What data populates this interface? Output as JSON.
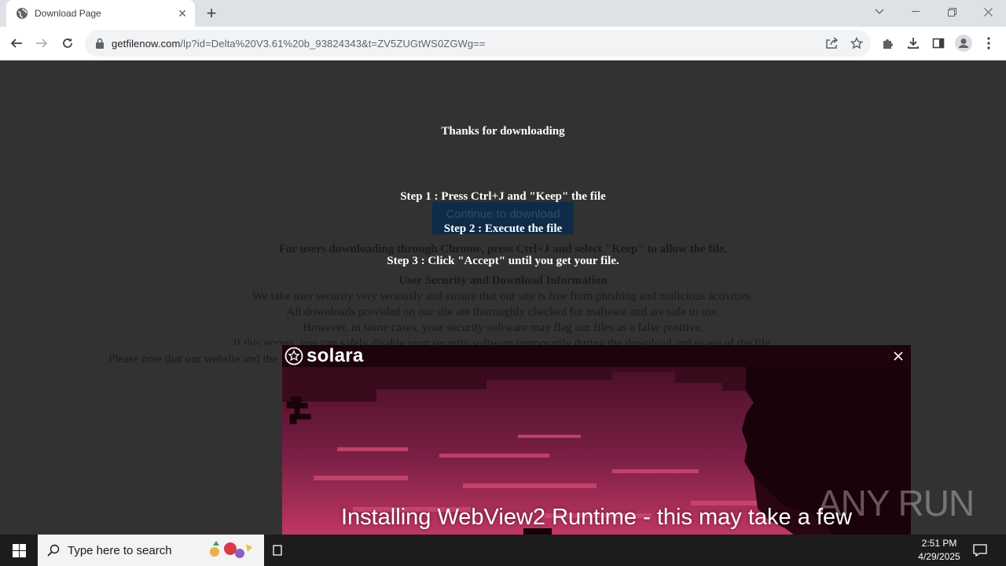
{
  "browser": {
    "tab_title": "Download Page",
    "tab_close": "✕",
    "new_tab": "+",
    "url_host": "getfilenow.com",
    "url_path": "/lp?id=Delta%20V3.61%20b_93824343&t=ZV5ZUGtWS0ZGWg=="
  },
  "page": {
    "thanks": "Thanks for downloading",
    "continue_button": "Continue to download",
    "step1": "Step 1 : Press Ctrl+J and \"Keep\" the file",
    "step2": "Step 2 : Execute the file",
    "step3": "Step 3 : Click \"Accept\" until you get your file.",
    "chrome_note": "For users downloading through Chrome, press Ctrl+J and select \"Keep\" to allow the file.",
    "security_heading": "User Security and Download Information",
    "security_lines": [
      "We take user security very seriously and ensure that our site is free from phishing and malicious activities.",
      "All downloads provided on our site are thoroughly checked for malware and are safe to use.",
      "However, in some cases, your security software may flag our files as a false positive.",
      "If this occurs, you can safely disable your security software temporarily during the download and usage of the file.",
      "Please note that our website and the"
    ]
  },
  "popup": {
    "app_name": "solara",
    "close": "✕",
    "status": "Installing WebView2 Runtime - this may take a few"
  },
  "taskbar": {
    "search_placeholder": "Type here to search",
    "time": "2:51 PM",
    "date": "4/29/2025"
  },
  "watermark": {
    "text": "ANY RUN"
  },
  "colors": {
    "page_bg": "#323232",
    "button_bg": "#0e2b49",
    "popup_bg": "#25040f",
    "art_pink": "#b8345f"
  }
}
